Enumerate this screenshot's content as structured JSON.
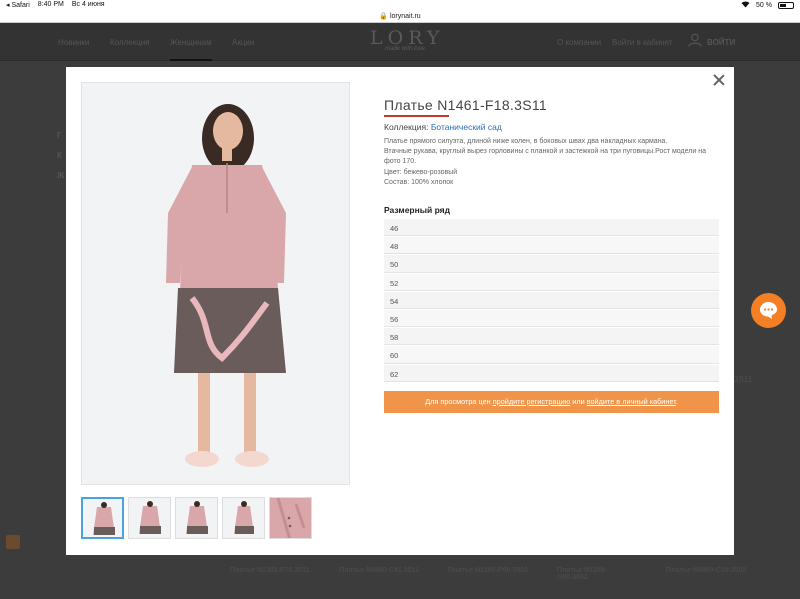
{
  "status_bar": {
    "app": "◂ Safari",
    "time": "8:40 PM",
    "date": "Вс 4 июня",
    "battery": "50 %",
    "battery_level": 0.5
  },
  "browser": {
    "url": "lorynait.ru",
    "dots": "•••"
  },
  "site_nav": {
    "items": [
      "Новинки",
      "Коллекция",
      "Женщинам",
      "Акции"
    ],
    "logo": "LORY",
    "logo_tag": "made with love",
    "right_items": [
      "О компании",
      "Войти в кабинет"
    ],
    "login": "ВОЙТИ"
  },
  "background": {
    "left_text": [
      "Г",
      "К",
      "Ж"
    ],
    "side_text": "3S11",
    "cards": [
      "Платье N1382-P70.3511",
      "Платье N0980-C41.3511",
      "Платье N1385-P90.3502",
      "Платье N1389-G90.3502",
      "Платье N0980-C19.3502"
    ]
  },
  "product": {
    "title": "Платье N1461-F18.3S11",
    "collection_label": "Коллекция:",
    "collection_value": "Ботанический сад",
    "description": [
      "Платье прямого силуэта, длиной ниже колен, в боковых швах два накладных кармана.",
      "Втачные рукава, круглый вырез горловины с планкой и застежкой на три пуговицы.Рост модели на фото 170.",
      "Цвет: бежево-розовый",
      "Состав: 100% хлопок"
    ],
    "sizes_title": "Размерный ряд",
    "sizes": [
      "46",
      "48",
      "50",
      "52",
      "54",
      "56",
      "58",
      "60",
      "62"
    ],
    "banner": {
      "text1": "Для просмотра цен ",
      "link1": "пройдите регистрацию",
      "text2": " или ",
      "link2": "войдите в личный кабинет",
      "text3": "."
    }
  },
  "colors": {
    "accent": "#f0944a",
    "link": "#2a6ebb",
    "title_underline": "#c0392b",
    "chat": "#f47f24",
    "thumb_active": "#4aa3df"
  },
  "icons": [
    "close-icon",
    "user-icon",
    "chat-icon",
    "lock-icon",
    "wifi-icon",
    "battery-icon"
  ]
}
